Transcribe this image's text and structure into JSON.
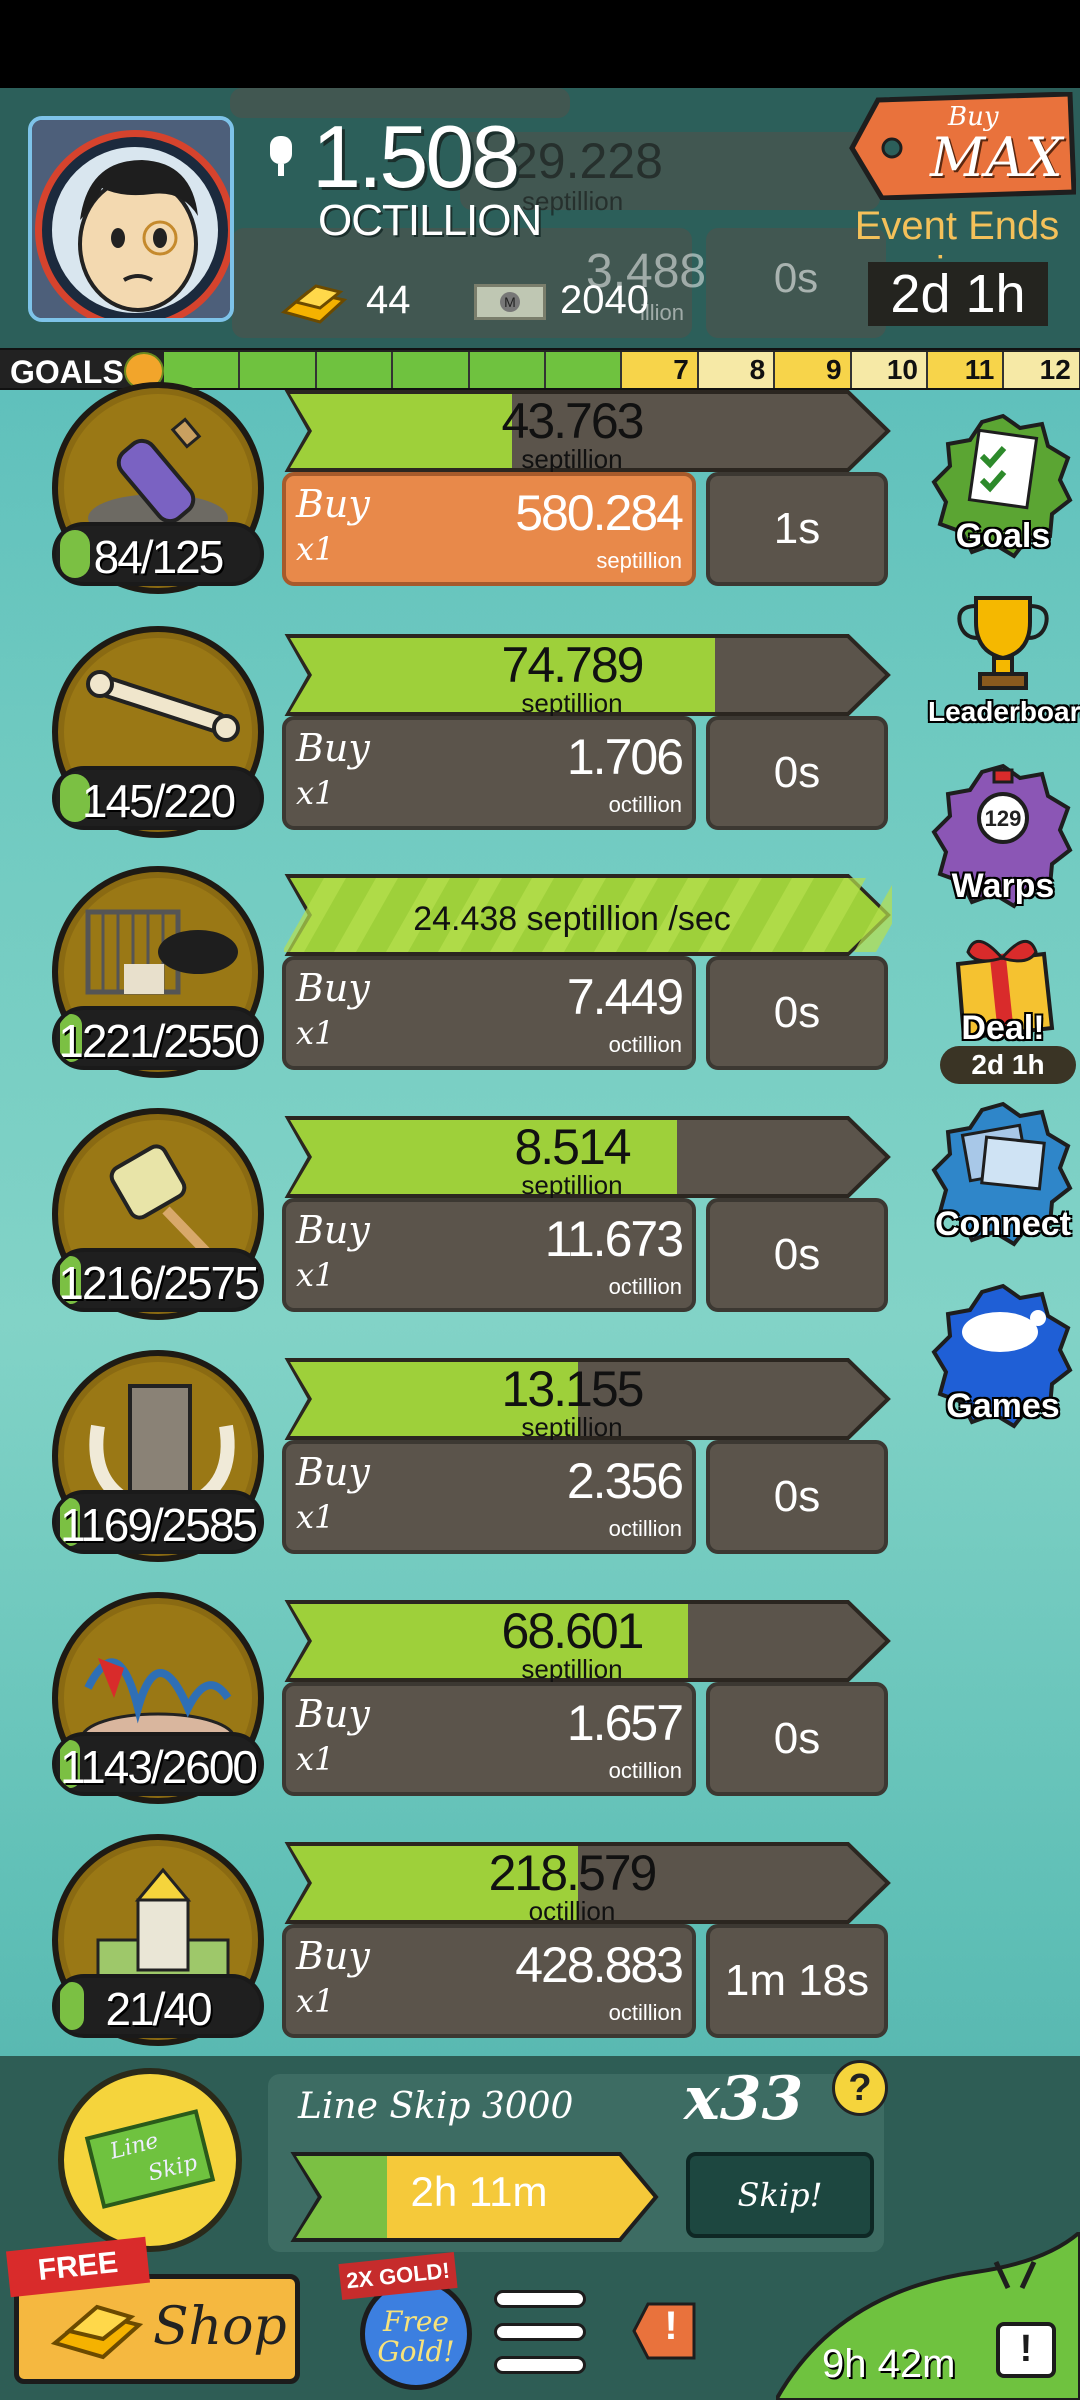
{
  "header": {
    "money_value": "1.508",
    "money_unit": "OCTILLION",
    "gold_count": "44",
    "megabucks_count": "2040",
    "buymax_top": "Buy",
    "buymax_label": "MAX",
    "event_label": "Event Ends in:",
    "event_time": "2d 1h",
    "ghost_value_1": "29.228",
    "ghost_unit_1": "septillion",
    "ghost_value_2": "3.488",
    "ghost_unit_2": "illion",
    "ghost_timer": "0s"
  },
  "goals": {
    "label": "GOALS",
    "completed": 6,
    "cells": [
      "",
      "",
      "",
      "",
      "",
      "",
      "7",
      "8",
      "9",
      "10",
      "11",
      "12"
    ]
  },
  "businesses": [
    {
      "count": "84/125",
      "count_progress": 0.67,
      "revenue_value": "43.763",
      "revenue_unit": "septillion",
      "revenue_progress": 0.38,
      "buy_label": "Buy",
      "buy_mult": "x1",
      "cost": "580.284",
      "cost_unit": "septillion",
      "timer": "1s",
      "affordable": true,
      "icon": "bottle-message-icon"
    },
    {
      "count": "145/220",
      "count_progress": 0.66,
      "revenue_value": "74.789",
      "revenue_unit": "septillion",
      "revenue_progress": 0.75,
      "buy_label": "Buy",
      "buy_mult": "x1",
      "cost": "1.706",
      "cost_unit": "octillion",
      "timer": "0s",
      "affordable": false,
      "icon": "bone-icon"
    },
    {
      "count": "1221/2550",
      "count_progress": 0.48,
      "revenue_rate": "24.438 septillion /sec",
      "revenue_progress": 1.0,
      "buy_label": "Buy",
      "buy_mult": "x1",
      "cost": "7.449",
      "cost_unit": "octillion",
      "timer": "0s",
      "affordable": false,
      "icon": "zoo-cage-icon"
    },
    {
      "count": "1216/2575",
      "count_progress": 0.47,
      "revenue_value": "8.514",
      "revenue_unit": "septillion",
      "revenue_progress": 0.68,
      "buy_label": "Buy",
      "buy_mult": "x1",
      "cost": "11.673",
      "cost_unit": "octillion",
      "timer": "0s",
      "affordable": false,
      "icon": "jar-net-icon"
    },
    {
      "count": "1169/2585",
      "count_progress": 0.45,
      "revenue_value": "13.155",
      "revenue_unit": "septillion",
      "revenue_progress": 0.5,
      "buy_label": "Buy",
      "buy_mult": "x1",
      "cost": "2.356",
      "cost_unit": "octillion",
      "timer": "0s",
      "affordable": false,
      "icon": "tusk-building-icon"
    },
    {
      "count": "1143/2600",
      "count_progress": 0.44,
      "revenue_value": "68.601",
      "revenue_unit": "septillion",
      "revenue_progress": 0.7,
      "buy_label": "Buy",
      "buy_mult": "x1",
      "cost": "1.657",
      "cost_unit": "octillion",
      "timer": "0s",
      "affordable": false,
      "icon": "rollercoaster-icon"
    },
    {
      "count": "21/40",
      "count_progress": 0.53,
      "revenue_value": "218.579",
      "revenue_unit": "octillion",
      "revenue_progress": 0.5,
      "buy_label": "Buy",
      "buy_mult": "x1",
      "cost": "428.883",
      "cost_unit": "octillion",
      "timer": "1m 18s",
      "affordable": false,
      "icon": "palace-icon"
    }
  ],
  "sidebar": {
    "goals": "Goals",
    "leaderboard": "Leaderboard",
    "warps": "Warps",
    "warps_count": "129",
    "deal": "Deal!",
    "deal_timer": "2d 1h",
    "connect": "Connect",
    "games": "Games"
  },
  "line_skip": {
    "title": "Line Skip 3000",
    "multiplier": "x33",
    "help": "?",
    "time": "2h 11m",
    "time_progress": 0.28,
    "skip_label": "Skip!",
    "coin_text_1": "Line",
    "coin_text_2": "Skip"
  },
  "bottom": {
    "free_label": "FREE",
    "shop_label": "Shop",
    "x2_label": "2X GOLD!",
    "free_gold_1": "Free",
    "free_gold_2": "Gold!",
    "alert": "!",
    "tv_time": "9h 42m",
    "tv_alert": "!"
  },
  "colors": {
    "progress_green": "#7bc043",
    "buy_active": "#e8894a",
    "panel_dark": "#5b544b",
    "header_bg": "#2c5f5a",
    "gold": "#f5d43c"
  }
}
